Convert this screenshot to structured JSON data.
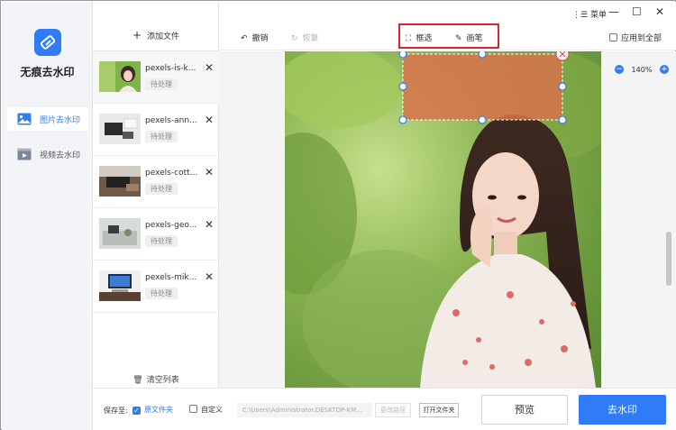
{
  "app": {
    "name": "无痕去水印",
    "accent": "#2f7cf6",
    "highlight": "#d9262e"
  },
  "nav": {
    "items": [
      {
        "label": "图片去水印",
        "icon": "image-icon",
        "active": true
      },
      {
        "label": "视频去水印",
        "icon": "video-icon",
        "active": false
      }
    ]
  },
  "files": {
    "add_label": "添加文件",
    "clear_label": "清空列表",
    "items": [
      {
        "name": "pexels-is-k...",
        "status": "待处理"
      },
      {
        "name": "pexels-ann...",
        "status": "待处理"
      },
      {
        "name": "pexels-cott...",
        "status": "待处理"
      },
      {
        "name": "pexels-geo...",
        "status": "待处理"
      },
      {
        "name": "pexels-mik...",
        "status": "待处理"
      }
    ]
  },
  "window": {
    "menu_label": "菜单"
  },
  "toolbar": {
    "undo_label": "撤销",
    "redo_label": "恢复",
    "select_label": "框选",
    "brush_label": "画笔",
    "apply_all_label": "应用到全部"
  },
  "canvas": {
    "zoom": "140%"
  },
  "bottom": {
    "save_to_label": "保存至:",
    "original_folder_label": "原文件夹",
    "custom_label": "自定义",
    "path_value": "C:\\Users\\Administrator.DESKTOP-KM...",
    "change_path_label": "更改路径",
    "open_folder_label": "打开文件夹",
    "preview_label": "预览",
    "remove_label": "去水印"
  }
}
